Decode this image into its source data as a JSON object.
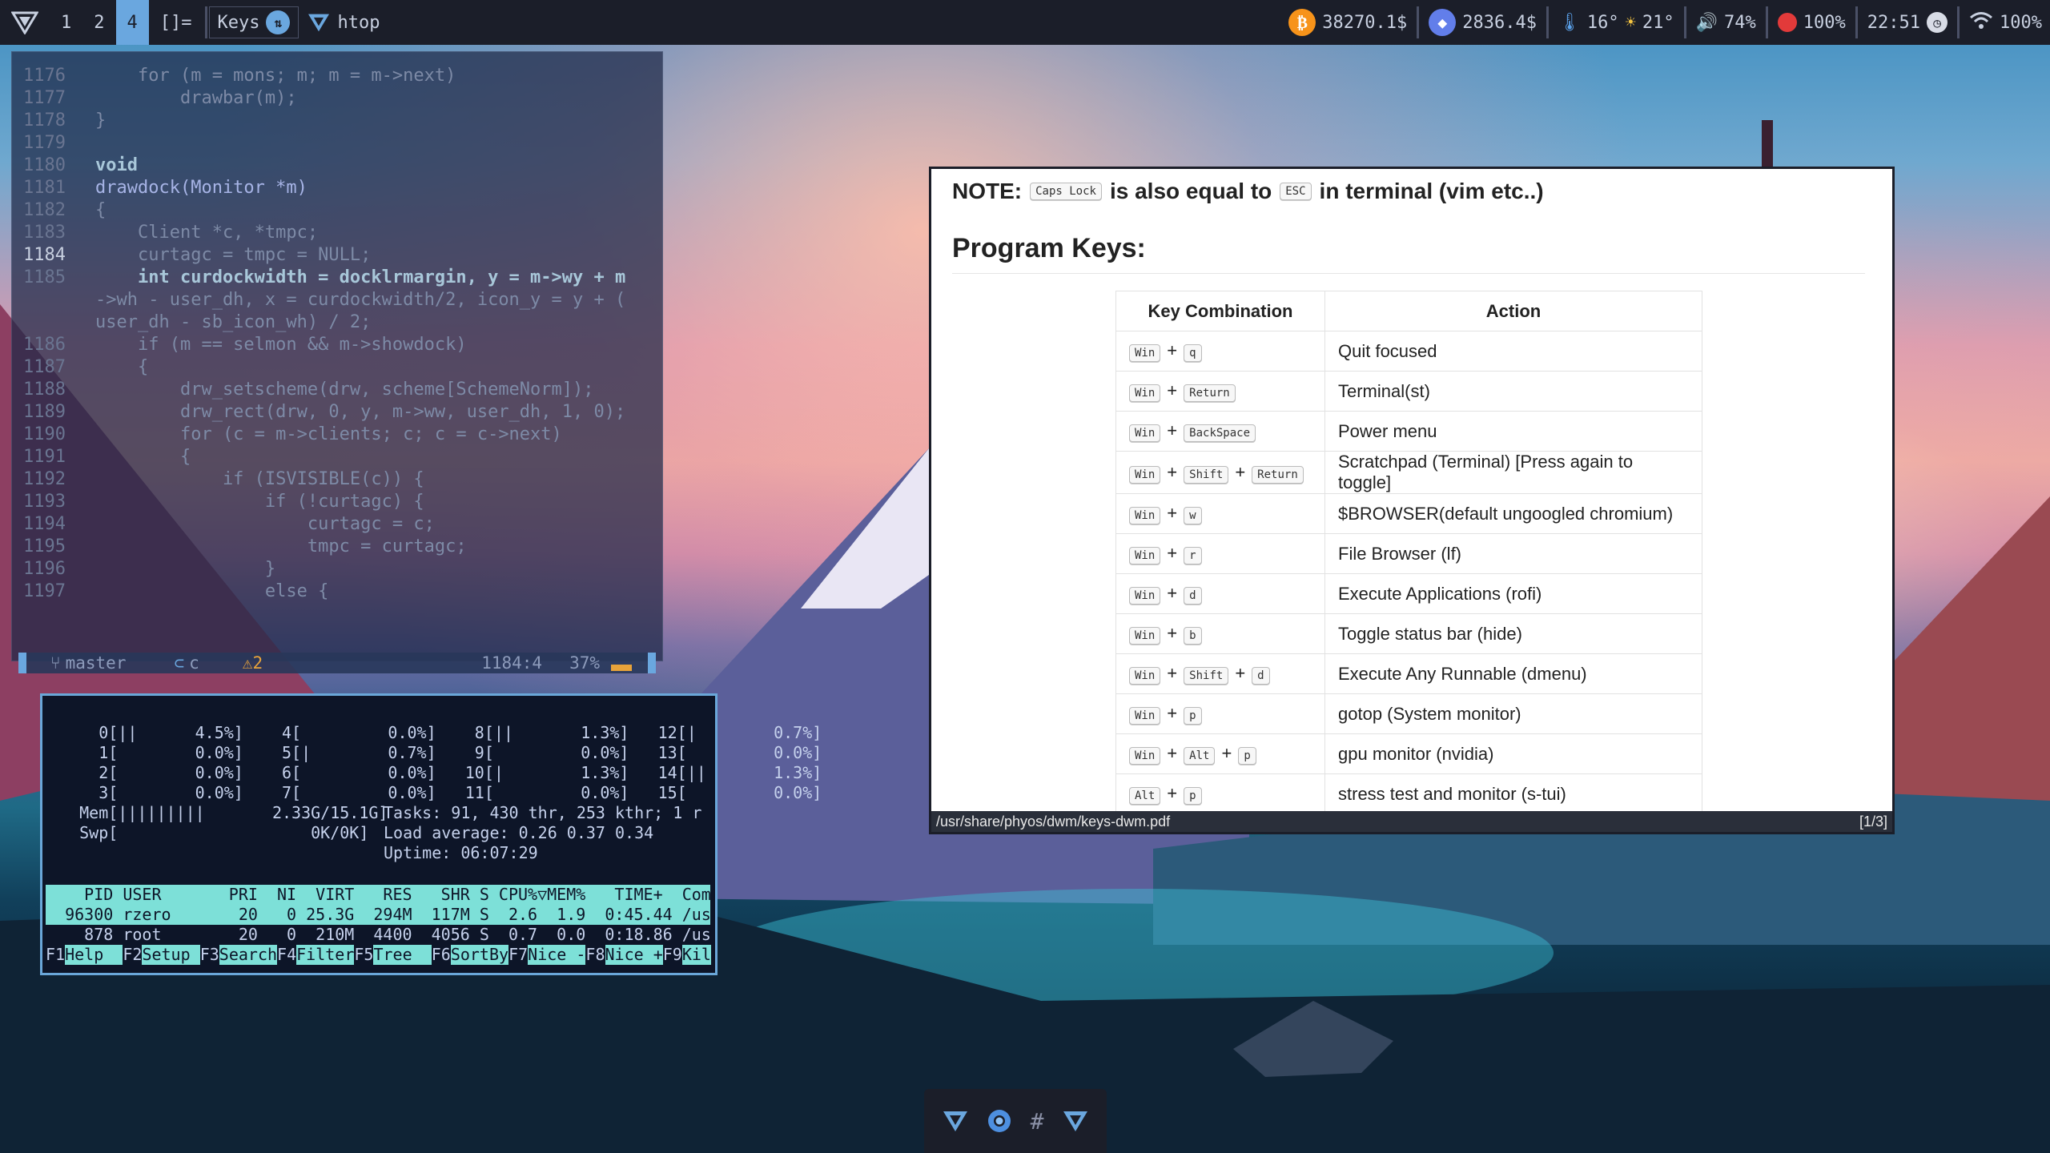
{
  "topbar": {
    "tags": [
      "1",
      "2",
      "4"
    ],
    "selected_tag": "4",
    "layout": "[]=",
    "window_label": "Keys",
    "app_title": "htop",
    "btc": "38270.1$",
    "eth": "2836.4$",
    "temp_cpu": "16°",
    "weather": "21°",
    "volume": "74%",
    "battery": "100%",
    "clock": "22:51",
    "wifi": "100%"
  },
  "editor": {
    "lines": [
      {
        "n": "1176",
        "t": "    for (m = mons; m; m = m->next)"
      },
      {
        "n": "1177",
        "t": "        drawbar(m);"
      },
      {
        "n": "1178",
        "t": "}"
      },
      {
        "n": "1179",
        "t": ""
      },
      {
        "n": "1180",
        "t": "void"
      },
      {
        "n": "1181",
        "t": "drawdock(Monitor *m)"
      },
      {
        "n": "1182",
        "t": "{"
      },
      {
        "n": "1183",
        "t": "    Client *c, *tmpc;"
      },
      {
        "n": "1184",
        "t": "    curtagc = tmpc = NULL;"
      },
      {
        "n": "1185",
        "t": "    int curdockwidth = docklrmargin, y = m->wy + m"
      },
      {
        "n": "",
        "t": "->wh - user_dh, x = curdockwidth/2, icon_y = y + ("
      },
      {
        "n": "",
        "t": "user_dh - sb_icon_wh) / 2;"
      },
      {
        "n": "1186",
        "t": "    if (m == selmon && m->showdock)"
      },
      {
        "n": "1187",
        "t": "    {"
      },
      {
        "n": "1188",
        "t": "        drw_setscheme(drw, scheme[SchemeNorm]);"
      },
      {
        "n": "1189",
        "t": "        drw_rect(drw, 0, y, m->ww, user_dh, 1, 0);"
      },
      {
        "n": "1190",
        "t": "        for (c = m->clients; c; c = c->next)"
      },
      {
        "n": "1191",
        "t": "        {"
      },
      {
        "n": "1192",
        "t": "            if (ISVISIBLE(c)) {"
      },
      {
        "n": "1193",
        "t": "                if (!curtagc) {"
      },
      {
        "n": "1194",
        "t": "                    curtagc = c;"
      },
      {
        "n": "1195",
        "t": "                    tmpc = curtagc;"
      },
      {
        "n": "1196",
        "t": "                }"
      },
      {
        "n": "1197",
        "t": "                else {"
      }
    ],
    "status": {
      "branch": "master",
      "lang": "c",
      "warnings": "2",
      "pos": "1184:4",
      "percent": "37%"
    }
  },
  "htop": {
    "cpu_rows": [
      "     0[||      4.5%]    4[         0.0%]    8[||       1.3%]   12[|        0.7%]",
      "     1[        0.0%]    5[|        0.7%]    9[         0.0%]   13[         0.0%]",
      "     2[        0.0%]    6[         0.0%]   10[|        1.3%]   14[||       1.3%]",
      "     3[        0.0%]    7[         0.0%]   11[         0.0%]   15[         0.0%]"
    ],
    "mem": "   Mem[|||||||||       2.33G/15.1G]",
    "swp": "   Swp[                    0K/0K]",
    "tasks": "Tasks: 91, 430 thr, 253 kthr; 1 r",
    "load": "Load average: 0.26 0.37 0.34",
    "uptime": "Uptime: 06:07:29",
    "header": "    PID USER       PRI  NI  VIRT   RES   SHR S CPU%▽MEM%   TIME+  Com",
    "procs": [
      "  96300 rzero       20   0 25.3G  294M  117M S  2.6  1.9  0:45.44 /us",
      "    878 root        20   0  210M  4400  4056 S  0.7  0.0  0:18.86 /us"
    ],
    "fkeys": [
      {
        "k": "F1",
        "l": "Help  "
      },
      {
        "k": "F2",
        "l": "Setup "
      },
      {
        "k": "F3",
        "l": "Search"
      },
      {
        "k": "F4",
        "l": "Filter"
      },
      {
        "k": "F5",
        "l": "Tree  "
      },
      {
        "k": "F6",
        "l": "SortBy"
      },
      {
        "k": "F7",
        "l": "Nice -"
      },
      {
        "k": "F8",
        "l": "Nice +"
      },
      {
        "k": "F9",
        "l": "Kil"
      }
    ]
  },
  "pdf": {
    "note_prefix": "NOTE:",
    "note_key1": "Caps Lock",
    "note_mid": "is also equal to",
    "note_key2": "ESC",
    "note_suffix": "in terminal (vim etc..)",
    "heading": "Program Keys:",
    "col_keys": "Key Combination",
    "col_action": "Action",
    "rows": [
      {
        "keys": [
          "Win",
          "q"
        ],
        "action": "Quit focused"
      },
      {
        "keys": [
          "Win",
          "Return"
        ],
        "action": "Terminal(st)"
      },
      {
        "keys": [
          "Win",
          "BackSpace"
        ],
        "action": "Power menu"
      },
      {
        "keys": [
          "Win",
          "Shift",
          "Return"
        ],
        "action": "Scratchpad (Terminal) [Press again to toggle]"
      },
      {
        "keys": [
          "Win",
          "w"
        ],
        "action": "$BROWSER(default ungoogled chromium)"
      },
      {
        "keys": [
          "Win",
          "r"
        ],
        "action": "File Browser (lf)"
      },
      {
        "keys": [
          "Win",
          "d"
        ],
        "action": "Execute Applications (rofi)"
      },
      {
        "keys": [
          "Win",
          "b"
        ],
        "action": "Toggle status bar (hide)"
      },
      {
        "keys": [
          "Win",
          "Shift",
          "d"
        ],
        "action": "Execute Any Runnable (dmenu)"
      },
      {
        "keys": [
          "Win",
          "p"
        ],
        "action": "gotop (System monitor)"
      },
      {
        "keys": [
          "Win",
          "Alt",
          "p"
        ],
        "action": "gpu monitor (nvidia)"
      },
      {
        "keys": [
          "Alt",
          "p"
        ],
        "action": "stress test and monitor (s-tui)"
      }
    ],
    "path": "/usr/share/phyos/dwm/keys-dwm.pdf",
    "page": "[1/3]"
  },
  "dock": {
    "items": [
      "phyos-icon",
      "chromium-icon",
      "hash-icon",
      "phyos-icon"
    ]
  }
}
